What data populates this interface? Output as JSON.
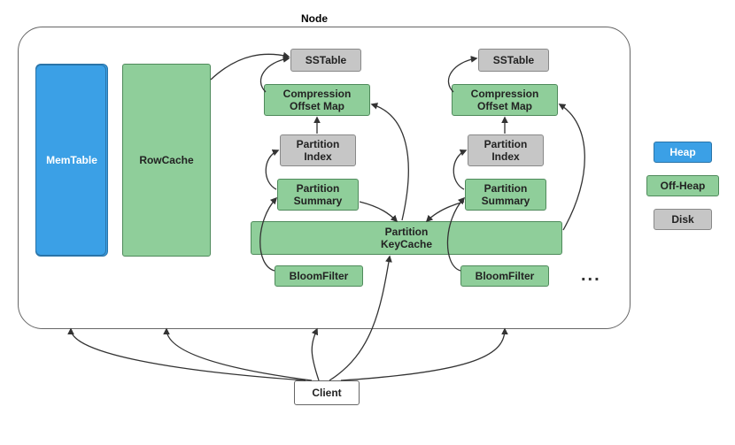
{
  "title": "Node",
  "components": {
    "memtable": "MemTable",
    "rowcache": "RowCache",
    "sstable": "SSTable",
    "compression_offset_map_line1": "Compression",
    "compression_offset_map_line2": "Offset Map",
    "partition_index_line1": "Partition",
    "partition_index_line2": "Index",
    "partition_summary_line1": "Partition",
    "partition_summary_line2": "Summary",
    "partition_keycache_line1": "Partition",
    "partition_keycache_line2": "KeyCache",
    "bloomfilter": "BloomFilter",
    "client": "Client",
    "ellipsis": "..."
  },
  "legend": {
    "heap": "Heap",
    "offheap": "Off-Heap",
    "disk": "Disk"
  },
  "chart_data": {
    "type": "diagram",
    "container": "Node",
    "external": [
      "Client"
    ],
    "legend": {
      "Heap": "blue",
      "Off-Heap": "green",
      "Disk": "gray"
    },
    "nodes": [
      {
        "id": "MemTable",
        "category": "Heap"
      },
      {
        "id": "RowCache",
        "category": "Off-Heap"
      },
      {
        "id": "SSTable_1",
        "label": "SSTable",
        "category": "Disk"
      },
      {
        "id": "SSTable_2",
        "label": "SSTable",
        "category": "Disk"
      },
      {
        "id": "CompressionOffsetMap_1",
        "label": "Compression Offset Map",
        "category": "Off-Heap"
      },
      {
        "id": "CompressionOffsetMap_2",
        "label": "Compression Offset Map",
        "category": "Off-Heap"
      },
      {
        "id": "PartitionIndex_1",
        "label": "Partition Index",
        "category": "Disk"
      },
      {
        "id": "PartitionIndex_2",
        "label": "Partition Index",
        "category": "Disk"
      },
      {
        "id": "PartitionSummary_1",
        "label": "Partition Summary",
        "category": "Off-Heap"
      },
      {
        "id": "PartitionSummary_2",
        "label": "Partition Summary",
        "category": "Off-Heap"
      },
      {
        "id": "PartitionKeyCache",
        "label": "Partition KeyCache",
        "category": "Off-Heap"
      },
      {
        "id": "BloomFilter_1",
        "label": "BloomFilter",
        "category": "Off-Heap"
      },
      {
        "id": "BloomFilter_2",
        "label": "BloomFilter",
        "category": "Off-Heap"
      },
      {
        "id": "Client",
        "category": "external"
      }
    ],
    "edges": [
      {
        "from": "Client",
        "to": "MemTable"
      },
      {
        "from": "Client",
        "to": "RowCache"
      },
      {
        "from": "Client",
        "to": "BloomFilter_1"
      },
      {
        "from": "Client",
        "to": "BloomFilter_2"
      },
      {
        "from": "Client",
        "to": "PartitionKeyCache"
      },
      {
        "from": "BloomFilter_1",
        "to": "PartitionSummary_1"
      },
      {
        "from": "BloomFilter_2",
        "to": "PartitionSummary_2"
      },
      {
        "from": "PartitionSummary_1",
        "to": "PartitionIndex_1"
      },
      {
        "from": "PartitionSummary_2",
        "to": "PartitionIndex_2"
      },
      {
        "from": "PartitionSummary_1",
        "to": "PartitionKeyCache"
      },
      {
        "from": "PartitionSummary_2",
        "to": "PartitionKeyCache"
      },
      {
        "from": "PartitionIndex_1",
        "to": "CompressionOffsetMap_1"
      },
      {
        "from": "PartitionIndex_2",
        "to": "CompressionOffsetMap_2"
      },
      {
        "from": "PartitionKeyCache",
        "to": "CompressionOffsetMap_1"
      },
      {
        "from": "PartitionKeyCache",
        "to": "CompressionOffsetMap_2"
      },
      {
        "from": "CompressionOffsetMap_1",
        "to": "SSTable_1"
      },
      {
        "from": "CompressionOffsetMap_2",
        "to": "SSTable_2"
      },
      {
        "from": "RowCache",
        "to": "SSTable_1"
      }
    ]
  }
}
